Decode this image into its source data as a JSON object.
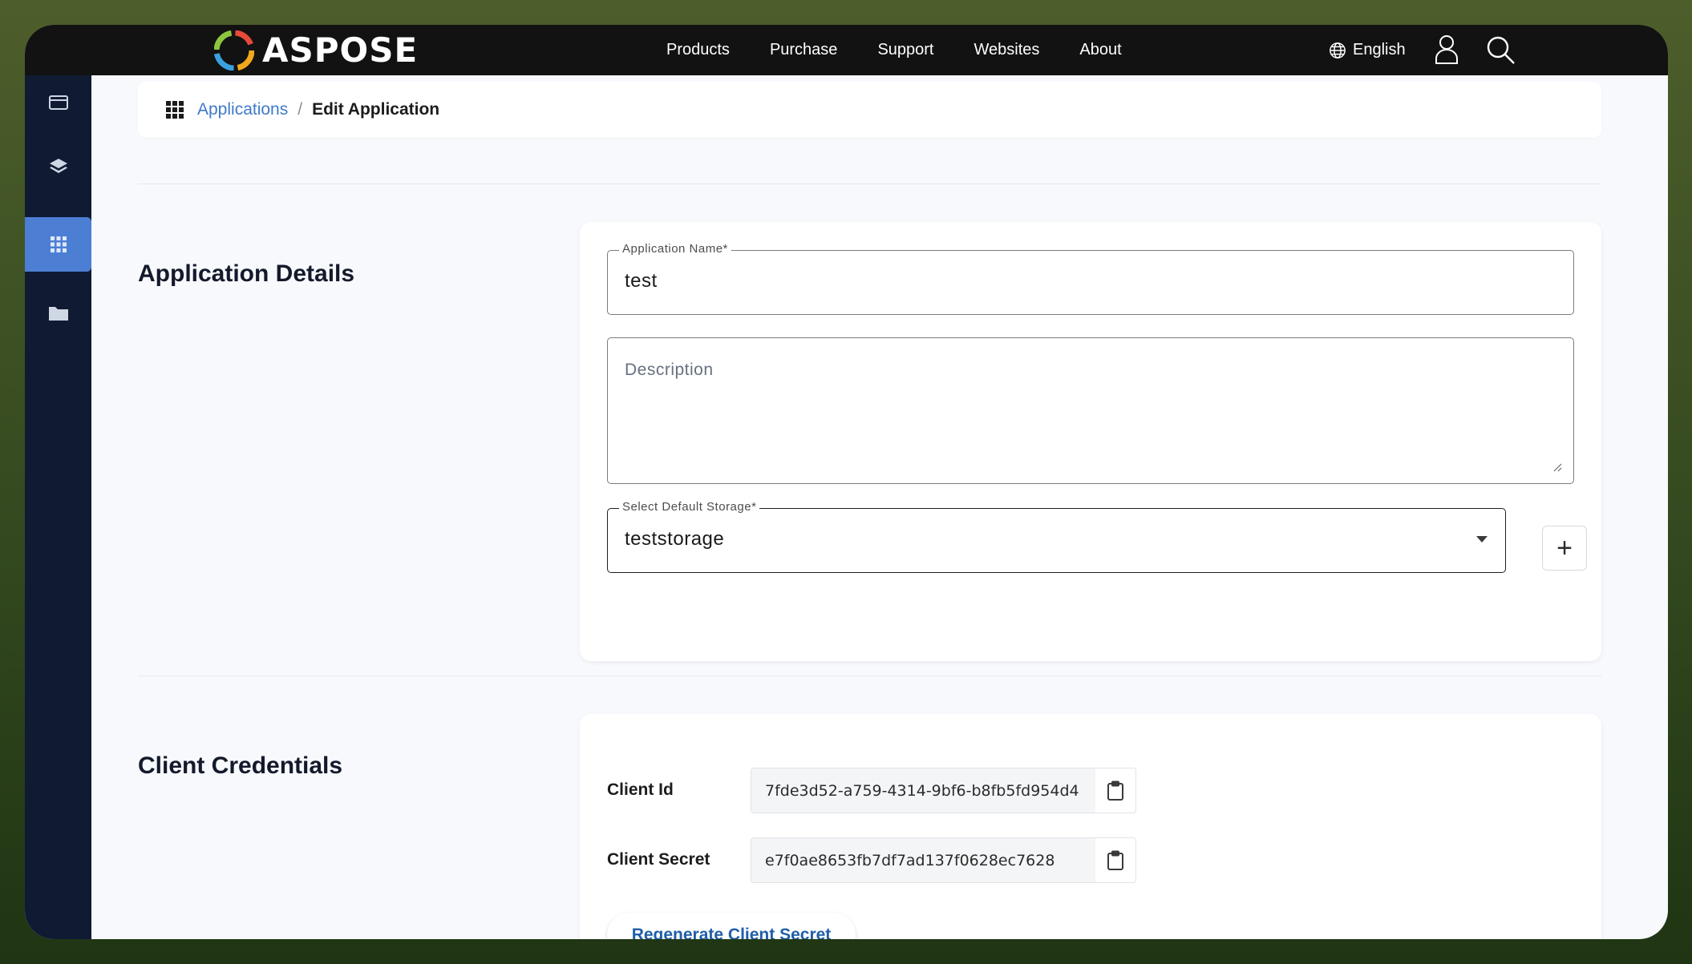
{
  "header": {
    "brand": "ASPOSE",
    "nav": [
      "Products",
      "Purchase",
      "Support",
      "Websites",
      "About"
    ],
    "language": "English"
  },
  "sidebar": {
    "items": [
      {
        "icon": "credit-card-icon",
        "active": false
      },
      {
        "icon": "layers-icon",
        "active": false
      },
      {
        "icon": "apps-grid-icon",
        "active": true
      },
      {
        "icon": "folder-icon",
        "active": false
      }
    ]
  },
  "breadcrumb": {
    "parent": "Applications",
    "separator": "/",
    "current": "Edit Application"
  },
  "details": {
    "title": "Application Details",
    "name_label": "Application Name*",
    "name_value": "test",
    "description_placeholder": "Description",
    "storage_label": "Select Default Storage*",
    "storage_value": "teststorage",
    "add_storage_label": "+"
  },
  "credentials": {
    "title": "Client Credentials",
    "client_id_label": "Client Id",
    "client_id_value": "7fde3d52-a759-4314-9bf6-b8fb5fd954d4",
    "client_secret_label": "Client Secret",
    "client_secret_value": "e7f0ae8653fb7df7ad137f0628ec7628",
    "regenerate_label": "Regenerate Client Secret"
  },
  "colors": {
    "accent": "#4c7fd4",
    "sidebar_bg": "#101a33",
    "topbar_bg": "#121212",
    "link": "#3f7ac9"
  }
}
